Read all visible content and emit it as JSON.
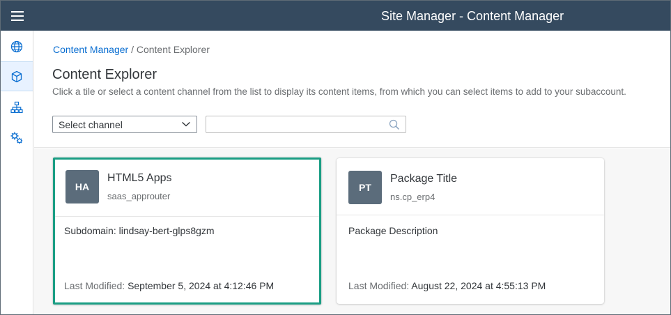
{
  "shell": {
    "title": "Site Manager - Content Manager"
  },
  "sidenav": {
    "items": [
      {
        "icon": "globe-icon",
        "active": false
      },
      {
        "icon": "cube-icon",
        "active": true
      },
      {
        "icon": "hierarchy-icon",
        "active": false
      },
      {
        "icon": "gears-icon",
        "active": false
      }
    ]
  },
  "breadcrumb": {
    "link": "Content Manager",
    "separator": "/",
    "current": "Content Explorer"
  },
  "page": {
    "title": "Content Explorer",
    "description": "Click a tile or select a content channel from the list to display its content items, from which you can select items to add to your subaccount."
  },
  "filters": {
    "channel_select": "Select channel",
    "search_value": "",
    "search_placeholder": ""
  },
  "tiles": [
    {
      "initials": "HA",
      "title": "HTML5 Apps",
      "subtitle": "saas_approuter",
      "description": "Subdomain: lindsay-bert-glps8gzm",
      "modified_label": "Last Modified:",
      "modified_value": "September 5, 2024 at 4:12:46 PM",
      "selected": true
    },
    {
      "initials": "PT",
      "title": "Package Title",
      "subtitle": "ns.cp_erp4",
      "description": "Package Description",
      "modified_label": "Last Modified:",
      "modified_value": "August 22, 2024 at 4:55:13 PM",
      "selected": false
    }
  ],
  "colors": {
    "shell_bg": "#354a5f",
    "link": "#0a6ed1",
    "selected_border": "#1a9e84",
    "avatar_bg": "#5b6c7b"
  }
}
